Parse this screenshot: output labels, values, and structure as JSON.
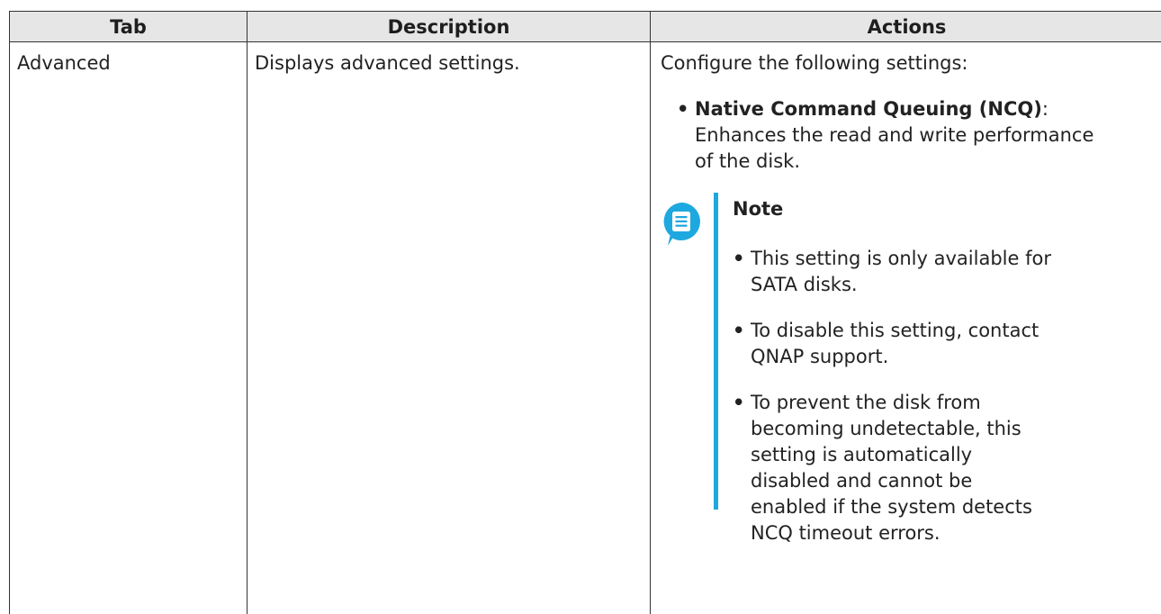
{
  "table": {
    "headers": {
      "tab": "Tab",
      "description": "Description",
      "actions": "Actions"
    },
    "rows": [
      {
        "tab": "Advanced",
        "description": "Displays advanced settings.",
        "actions": {
          "intro": "Configure the following settings:",
          "settings": [
            {
              "term": "Native Command Queuing (NCQ)",
              "separator": ":",
              "line1": "Enhances the read and write performance",
              "line2": "of the disk."
            }
          ],
          "note": {
            "icon": "note-icon",
            "accent_color": "#1ea8e0",
            "title": "Note",
            "items": [
              {
                "lines": [
                  "This setting is only available for",
                  "SATA disks."
                ]
              },
              {
                "lines": [
                  "To disable this setting, contact",
                  "QNAP support."
                ]
              },
              {
                "lines": [
                  "To prevent the disk from",
                  "becoming undetectable, this",
                  "setting is automatically",
                  "disabled and cannot be",
                  "enabled if the system detects",
                  "NCQ timeout errors."
                ]
              }
            ]
          }
        }
      }
    ]
  },
  "bullet_glyph": "•"
}
